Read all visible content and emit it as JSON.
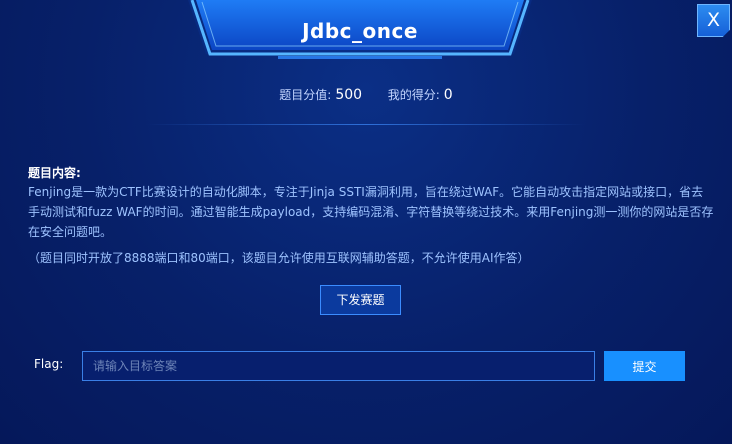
{
  "dialog": {
    "title": "Jdbc_once",
    "close_label": "X"
  },
  "score": {
    "points_label": "题目分值:",
    "points_value": "500",
    "my_score_label": "我的得分:",
    "my_score_value": "0"
  },
  "content": {
    "heading": "题目内容:",
    "body": "Fenjing是一款为CTF比赛设计的自动化脚本，专注于Jinja SSTI漏洞利用，旨在绕过WAF。它能自动攻击指定网站或接口，省去手动测试和fuzz WAF的时间。通过智能生成payload，支持编码混淆、字符替换等绕过技术。来用Fenjing测一测你的网站是否存在安全问题吧。",
    "note": "（题目同时开放了8888端口和80端口，该题目允许使用互联网辅助答题，不允许使用AI作答）"
  },
  "actions": {
    "issue_label": "下发赛题",
    "submit_label": "提交"
  },
  "flag": {
    "label": "Flag:",
    "placeholder": "请输入目标答案",
    "value": ""
  },
  "colors": {
    "background": "#072069",
    "accent": "#1890ff",
    "title_plate": "#1a6cf0",
    "body_text": "#9ec3ff"
  }
}
